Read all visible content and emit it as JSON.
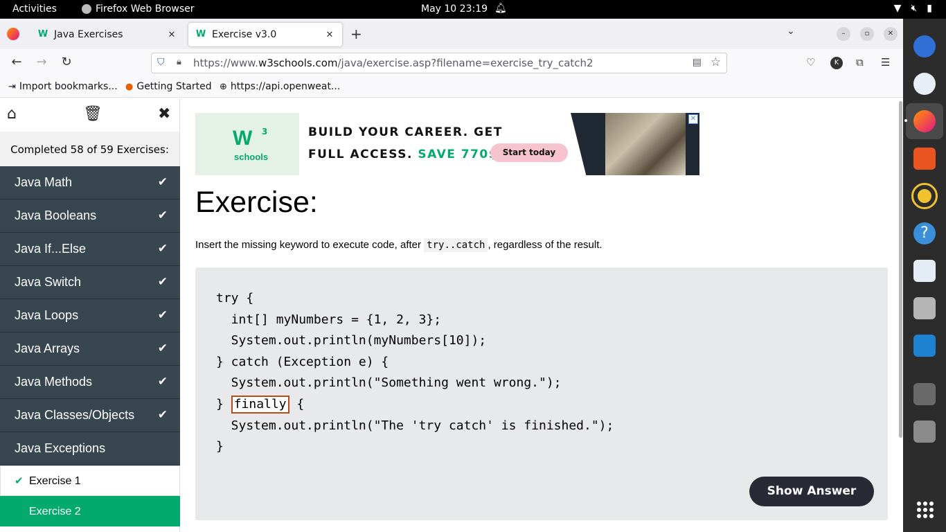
{
  "system": {
    "activities": "Activities",
    "app_name": "Firefox Web Browser",
    "clock": "May 10  23:19"
  },
  "browser": {
    "tabs": [
      {
        "label": "Java Exercises",
        "active": false
      },
      {
        "label": "Exercise v3.0",
        "active": true
      }
    ],
    "url_prefix": "https://www.",
    "url_domain": "w3schools.com",
    "url_path": "/java/exercise.asp?filename=exercise_try_catch2",
    "avatar_letter": "K",
    "bookmarks": [
      {
        "label": "Import bookmarks...",
        "icon": "import-icon"
      },
      {
        "label": "Getting Started",
        "icon": "firefox-icon"
      },
      {
        "label": "https://api.openweat...",
        "icon": "globe-icon"
      }
    ]
  },
  "sidebar": {
    "completed_text": "Completed 58 of 59 Exercises:",
    "categories": [
      {
        "label": "Java Math",
        "done": true
      },
      {
        "label": "Java Booleans",
        "done": true
      },
      {
        "label": "Java If...Else",
        "done": true
      },
      {
        "label": "Java Switch",
        "done": true
      },
      {
        "label": "Java Loops",
        "done": true
      },
      {
        "label": "Java Arrays",
        "done": true
      },
      {
        "label": "Java Methods",
        "done": true
      },
      {
        "label": "Java Classes/Objects",
        "done": true
      },
      {
        "label": "Java Exceptions",
        "done": false
      }
    ],
    "sub_items": [
      {
        "label": "Exercise 1",
        "done": true
      },
      {
        "label": "Exercise 2",
        "current": true
      }
    ]
  },
  "ad": {
    "logo_text": "W",
    "logo_sup": "3",
    "logo_sub": "schools",
    "headline_1": "BUILD YOUR CAREER. GET",
    "headline_2": "FULL ACCESS.",
    "headline_save": "SAVE 770$",
    "cta": "Start today"
  },
  "exercise": {
    "title": "Exercise:",
    "desc_before": "Insert the missing keyword to execute code, after ",
    "desc_code": "try..catch",
    "desc_after": ", regardless of the result.",
    "code_lines": [
      "try {",
      "  int[] myNumbers = {1, 2, 3};",
      "  System.out.println(myNumbers[10]);",
      "} catch (Exception e) {",
      "  System.out.println(\"Something went wrong.\");"
    ],
    "blank_prefix": "} ",
    "blank_value": "finally",
    "blank_suffix": " {",
    "code_lines_after": [
      "  System.out.println(\"The 'try catch' is finished.\");",
      "}"
    ],
    "show_answer": "Show Answer"
  },
  "colors": {
    "accent_green": "#04aa6d",
    "sidebar_bg": "#384650",
    "answer_btn": "#282a35"
  }
}
